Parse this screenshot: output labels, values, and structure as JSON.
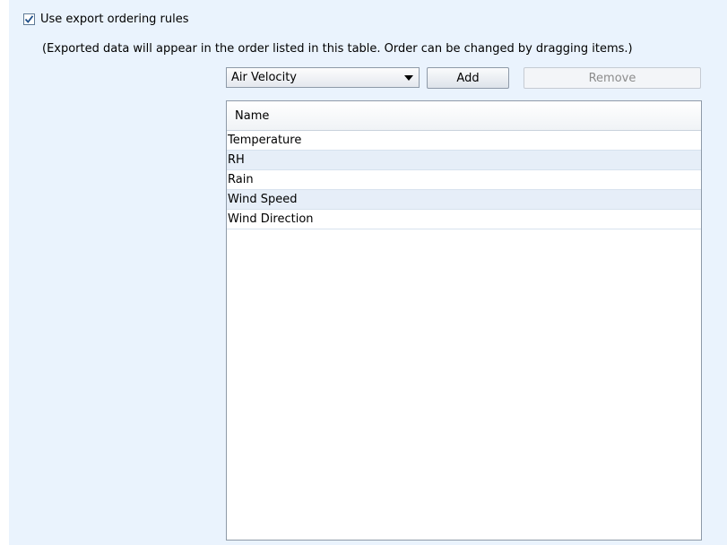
{
  "export_ordering": {
    "checkbox_label": "Use export ordering rules",
    "checked": true,
    "hint": "(Exported data will appear in the order listed in this table. Order can be changed by dragging items.)"
  },
  "controls": {
    "combo_value": "Air Velocity",
    "add_label": "Add",
    "remove_label": "Remove",
    "remove_enabled": false
  },
  "table": {
    "header": "Name",
    "rows": [
      "Temperature",
      "RH",
      "Rain",
      "Wind Speed",
      "Wind Direction"
    ]
  }
}
